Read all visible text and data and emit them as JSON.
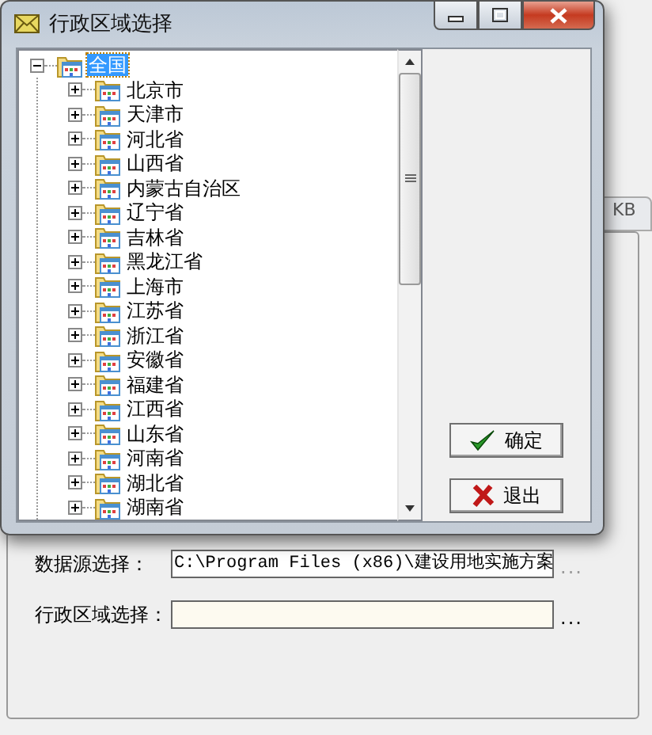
{
  "window": {
    "title": "行政区域选择"
  },
  "tree": {
    "label": "全国",
    "expanded": true,
    "selected": true,
    "children": [
      {
        "label": "北京市",
        "expanded": false
      },
      {
        "label": "天津市",
        "expanded": false
      },
      {
        "label": "河北省",
        "expanded": false
      },
      {
        "label": "山西省",
        "expanded": false
      },
      {
        "label": "内蒙古自治区",
        "expanded": false
      },
      {
        "label": "辽宁省",
        "expanded": false
      },
      {
        "label": "吉林省",
        "expanded": false
      },
      {
        "label": "黑龙江省",
        "expanded": false
      },
      {
        "label": "上海市",
        "expanded": false
      },
      {
        "label": "江苏省",
        "expanded": false
      },
      {
        "label": "浙江省",
        "expanded": false
      },
      {
        "label": "安徽省",
        "expanded": false
      },
      {
        "label": "福建省",
        "expanded": false
      },
      {
        "label": "江西省",
        "expanded": false
      },
      {
        "label": "山东省",
        "expanded": false
      },
      {
        "label": "河南省",
        "expanded": false
      },
      {
        "label": "湖北省",
        "expanded": false
      },
      {
        "label": "湖南省",
        "expanded": false
      }
    ]
  },
  "buttons": [
    {
      "kind": "ok",
      "label": "确定"
    },
    {
      "kind": "exit",
      "label": "退出"
    }
  ],
  "background": {
    "tab_text": "KB",
    "fields": [
      {
        "label": "数据源选择：",
        "value": "C:\\Program Files (x86)\\建设用地实施方案",
        "highlighted": false,
        "browse": "...",
        "disabled": true
      },
      {
        "label": "行政区域选择：",
        "highlighted": true,
        "browse": "...",
        "disabled": false
      }
    ]
  }
}
